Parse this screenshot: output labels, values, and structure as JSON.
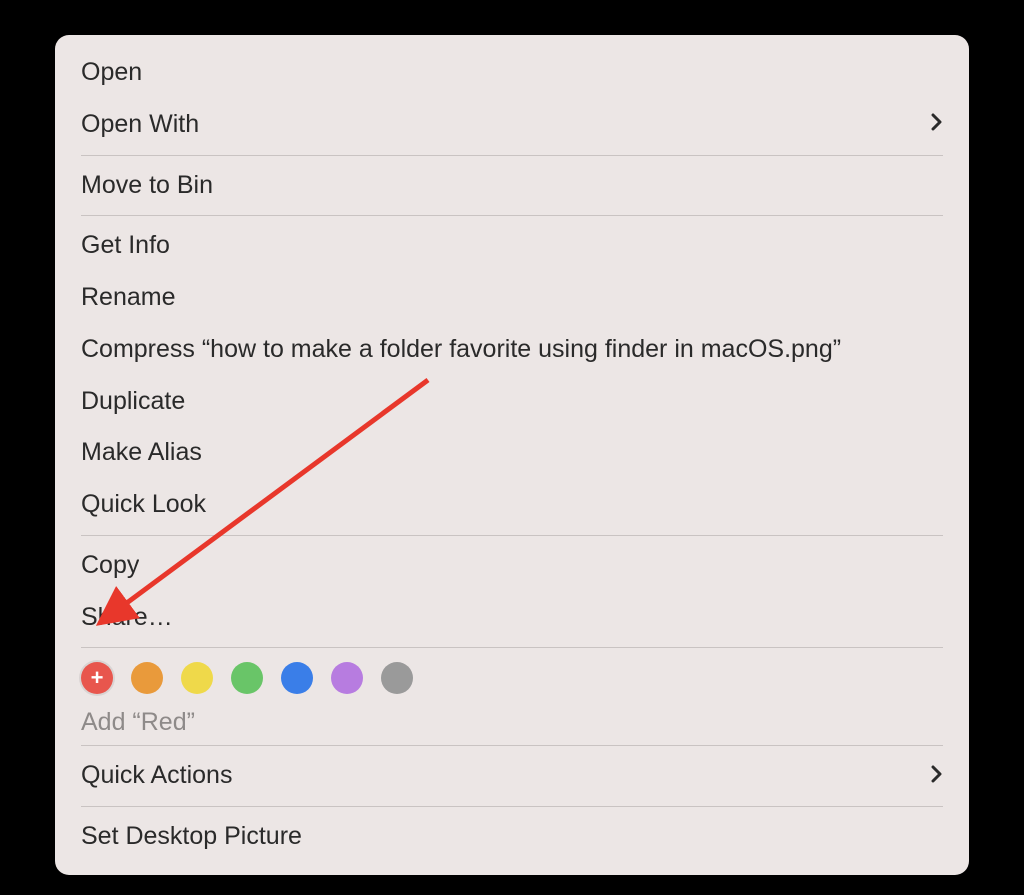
{
  "menu": {
    "open": "Open",
    "open_with": "Open With",
    "move_to_bin": "Move to Bin",
    "get_info": "Get Info",
    "rename": "Rename",
    "compress": "Compress “how to make a folder favorite using finder in macOS.png”",
    "duplicate": "Duplicate",
    "make_alias": "Make Alias",
    "quick_look": "Quick Look",
    "copy": "Copy",
    "share": "Share…",
    "quick_actions": "Quick Actions",
    "set_desktop": "Set Desktop Picture"
  },
  "tags": {
    "caption": "Add “Red”",
    "colors": [
      {
        "name": "Red",
        "hex": "#e8564d",
        "selected": true
      },
      {
        "name": "Orange",
        "hex": "#e99a3b",
        "selected": false
      },
      {
        "name": "Yellow",
        "hex": "#efd94a",
        "selected": false
      },
      {
        "name": "Green",
        "hex": "#69c568",
        "selected": false
      },
      {
        "name": "Blue",
        "hex": "#3a7ee8",
        "selected": false
      },
      {
        "name": "Purple",
        "hex": "#b77ce0",
        "selected": false
      },
      {
        "name": "Gray",
        "hex": "#9a9a9a",
        "selected": false
      }
    ]
  },
  "annotation": {
    "arrow_color": "#e8372b"
  }
}
